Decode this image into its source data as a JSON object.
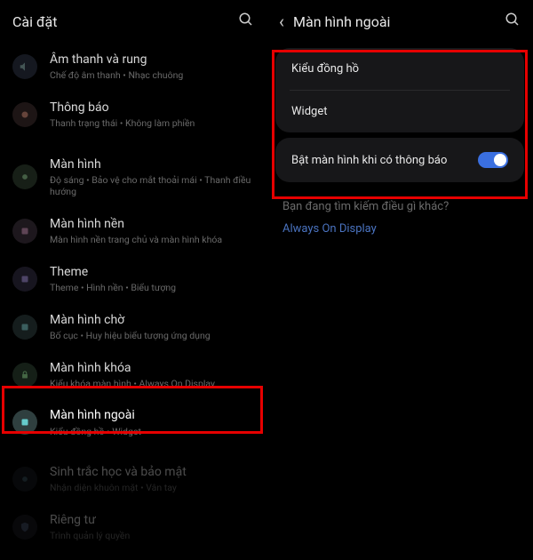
{
  "left": {
    "title": "Cài đặt",
    "items": [
      {
        "title": "Âm thanh và rung",
        "sub": "Chế độ âm thanh • Nhạc chuông"
      },
      {
        "title": "Thông báo",
        "sub": "Thanh trạng thái • Không làm phiền"
      },
      {
        "title": "Màn hình",
        "sub": "Độ sáng • Bảo vệ cho mắt thoải mái • Thanh điều hướng"
      },
      {
        "title": "Màn hình nền",
        "sub": "Màn hình nền trang chủ và màn hình khóa"
      },
      {
        "title": "Theme",
        "sub": "Theme • Hình nền • Biểu tượng"
      },
      {
        "title": "Màn hình chờ",
        "sub": "Bố cục • Huy hiệu biểu tượng ứng dụng"
      },
      {
        "title": "Màn hình khóa",
        "sub": "Kiểu khóa màn hình • Always On Display"
      },
      {
        "title": "Màn hình ngoài",
        "sub": "Kiểu đồng hồ • Widget"
      },
      {
        "title": "Sinh trắc học và bảo mật",
        "sub": "Nhận diện khuôn mặt • Vân tay"
      },
      {
        "title": "Riêng tư",
        "sub": "Trình quản lý quyền"
      }
    ]
  },
  "right": {
    "title": "Màn hình ngoài",
    "rows": {
      "clock": "Kiểu đồng hồ",
      "widget": "Widget",
      "toggle_label": "Bật màn hình khi có thông báo"
    },
    "hint": "Bạn đang tìm kiếm điều gì khác?",
    "link": "Always On Display"
  }
}
